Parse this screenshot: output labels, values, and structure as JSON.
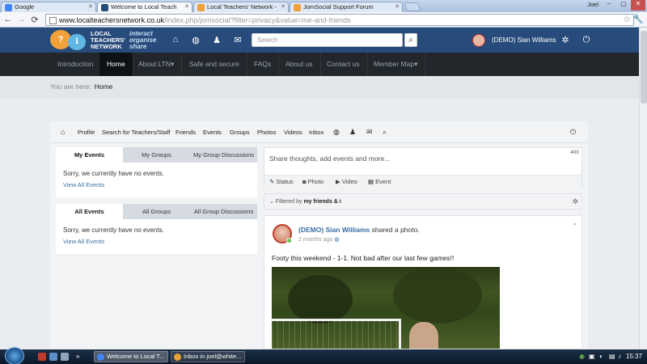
{
  "browser": {
    "tabs": [
      {
        "label": "Google",
        "favicon_color": "#4285f4"
      },
      {
        "label": "Welcome to Local Teach",
        "favicon_color": "#274b7a",
        "active": true
      },
      {
        "label": "Local Teachers' Network -",
        "favicon_color": "#f2a13a"
      },
      {
        "label": "JomSocial Support Forum",
        "favicon_color": "#f2a13a"
      }
    ],
    "window_user": "Joel",
    "url_host": "www.localteachersnetwork.co.uk",
    "url_path": "/index.php/jomsocial?filter=privacy&value=me-and-friends"
  },
  "site": {
    "logo_text": [
      "LOCAL",
      "TEACHERS'",
      "NETWORK"
    ],
    "logo_tagline": [
      "interact",
      "organise",
      "share"
    ],
    "search_placeholder": "Search",
    "user_name": "(DEMO) Sian Williams"
  },
  "nav": [
    {
      "label": "Introduction"
    },
    {
      "label": "Home",
      "active": true
    },
    {
      "label": "About LTN▾"
    },
    {
      "label": "Safe and secure"
    },
    {
      "label": "FAQs"
    },
    {
      "label": "About us"
    },
    {
      "label": "Contact us"
    },
    {
      "label": "Member Map▾"
    }
  ],
  "breadcrumb": {
    "prefix": "You are here:",
    "current": "Home"
  },
  "js_toolbar": [
    "Profile",
    "Search for Teachers/Staff",
    "Friends",
    "Events",
    "Groups",
    "Photos",
    "Videos",
    "Inbox"
  ],
  "events_panel": {
    "tabs": [
      "My Events",
      "My Groups",
      "My Group Discussions"
    ],
    "message": "Sorry, we currently have no events.",
    "link": "View All Events"
  },
  "all_events_panel": {
    "tabs": [
      "All Events",
      "All Groups",
      "All Group Discussions"
    ],
    "message": "Sorry, we currently have no events.",
    "link": "View All Events"
  },
  "composer": {
    "placeholder": "Share thoughts, add events and more...",
    "char_count": "400",
    "actions": [
      "Status",
      "Photo",
      "Video",
      "Event"
    ]
  },
  "filter": {
    "prefix": "Filtered by",
    "value": "my friends & i"
  },
  "post": {
    "author": "(DEMO) Sian Williams",
    "action": "shared a photo.",
    "time": "2 months ago",
    "body": "Footy this weekend - 1-1. Not bad after our last few games!!"
  },
  "taskbar": {
    "tasks": [
      {
        "label": "Welcome to Local T...",
        "icon_color": "#4285f4",
        "active": true
      },
      {
        "label": "Inbox in joel@white...",
        "icon_color": "#e8a33a"
      }
    ],
    "clock": "15:37"
  }
}
